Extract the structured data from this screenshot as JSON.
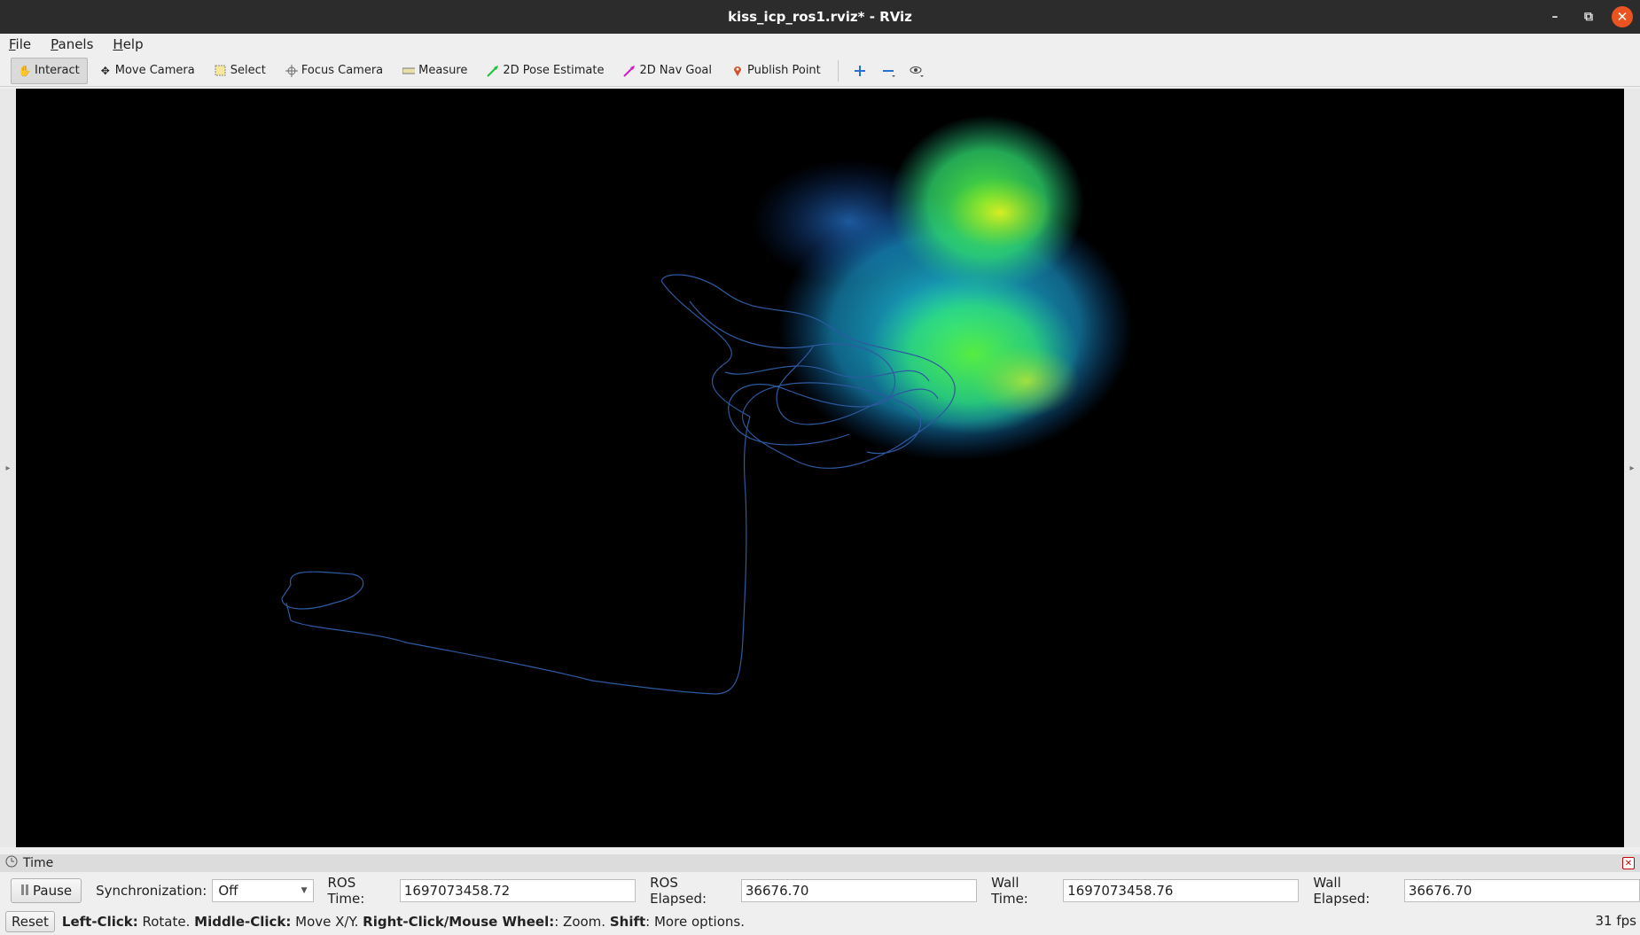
{
  "window": {
    "title": "kiss_icp_ros1.rviz* - RViz"
  },
  "menu": {
    "file": "File",
    "panels": "Panels",
    "help": "Help"
  },
  "toolbar": {
    "interact": "Interact",
    "move_camera": "Move Camera",
    "select": "Select",
    "focus_camera": "Focus Camera",
    "measure": "Measure",
    "pose_estimate": "2D Pose Estimate",
    "nav_goal": "2D Nav Goal",
    "publish_point": "Publish Point"
  },
  "time_panel": {
    "title": "Time",
    "pause": "Pause",
    "sync_label": "Synchronization:",
    "sync_value": "Off",
    "ros_time_label": "ROS Time:",
    "ros_time": "1697073458.72",
    "ros_elapsed_label": "ROS Elapsed:",
    "ros_elapsed": "36676.70",
    "wall_time_label": "Wall Time:",
    "wall_time": "1697073458.76",
    "wall_elapsed_label": "Wall Elapsed:",
    "wall_elapsed": "36676.70"
  },
  "status": {
    "reset": "Reset",
    "left_click": "Left-Click:",
    "left_click_desc": " Rotate. ",
    "middle_click": "Middle-Click:",
    "middle_click_desc": " Move X/Y. ",
    "right_click": "Right-Click/Mouse Wheel:",
    "right_click_desc": ": Zoom. ",
    "shift": "Shift",
    "shift_desc": ": More options.",
    "fps": "31 fps"
  },
  "colors": {
    "path": "#2d5aa0",
    "cloud_cyan": "#1fd0e0",
    "cloud_green": "#3ef05a",
    "cloud_yellow": "#e8f020"
  }
}
